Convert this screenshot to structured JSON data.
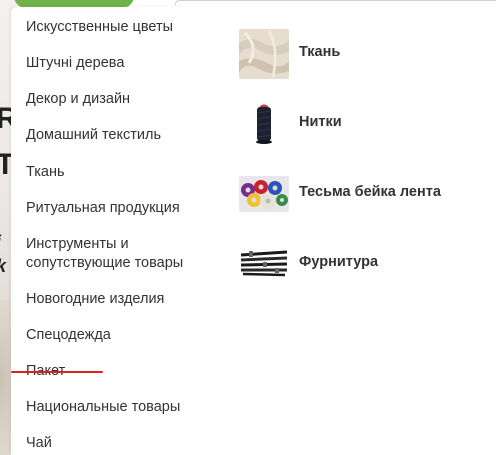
{
  "menu": {
    "categories": [
      {
        "label": "Искусственные цветы"
      },
      {
        "label": "Штучні дерева"
      },
      {
        "label": "Декор и дизайн"
      },
      {
        "label": "Домашний текстиль"
      },
      {
        "label": "Ткань"
      },
      {
        "label": "Ритуальная продукция"
      },
      {
        "label": "Инструменты и"
      },
      {
        "label": "сопутствующие товары"
      },
      {
        "label": "Новогодние изделия"
      },
      {
        "label": "Спецодежда"
      },
      {
        "label": "Пакет"
      },
      {
        "label": "Национальные товары"
      },
      {
        "label": "Чай"
      }
    ],
    "subcategories": [
      {
        "label": "Ткань",
        "icon": "fabric-image"
      },
      {
        "label": "Нитки",
        "icon": "thread-spool-image"
      },
      {
        "label": "Тесьма бейка лента",
        "icon": "ribbon-image"
      },
      {
        "label": "Фурнитура",
        "icon": "zippers-image"
      }
    ]
  },
  "accent_colors": {
    "underline": "#d9231d",
    "tab": "#6fb34a"
  }
}
